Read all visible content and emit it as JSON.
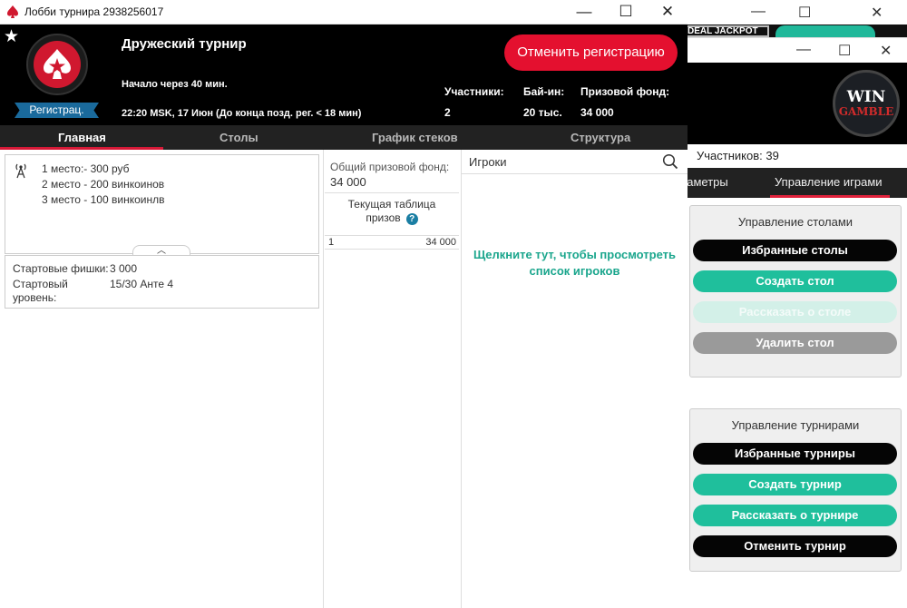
{
  "background_window": {
    "jackpot_label": "DEAL JACKPOT",
    "participants": "Участников: 39",
    "tabs": [
      {
        "label": "раметры"
      },
      {
        "label": "Управление играми"
      }
    ],
    "logo": {
      "line1": "WIN",
      "line2": "GAMBLE"
    },
    "table_panel": {
      "title": "Управление столами",
      "buttons": [
        "Избранные столы",
        "Создать стол",
        "Рассказать о столе",
        "Удалить стол"
      ]
    },
    "tournament_panel": {
      "title": "Управление турнирами",
      "buttons": [
        "Избранные турниры",
        "Создать турнир",
        "Рассказать о турнире",
        "Отменить турнир"
      ]
    }
  },
  "window": {
    "title": "Лобби турнира 2938256017",
    "controls": {
      "minimize": "—",
      "maximize": "☐",
      "close": "✕"
    }
  },
  "header": {
    "tournament_name": "Дружеский турнир",
    "starts_in": "Начало через 40 мин.",
    "date_info": "22:20 MSK, 17 Июн (До конца позд. рег. < 18 мин)",
    "status_badge": "Регистрац.",
    "unregister_label": "Отменить регистрацию",
    "stats": [
      {
        "label": "Участники:",
        "value": "2"
      },
      {
        "label": "Бай-ин:",
        "value": "20 тыс."
      },
      {
        "label": "Призовой фонд:",
        "value": "34 000"
      }
    ]
  },
  "tabs": [
    {
      "label": "Главная"
    },
    {
      "label": "Столы"
    },
    {
      "label": "График стеков"
    },
    {
      "label": "Структура"
    }
  ],
  "main": {
    "prizes": [
      "1 место:- 300 руб",
      "2 место - 200 винкоинов",
      "3 место - 100 винкоинлв"
    ],
    "collapse_glyph": "︿",
    "starting_chips_label": "Стартовые фишки:",
    "starting_chips_value": "3 000",
    "starting_level_label_1": "Стартовый",
    "starting_level_label_2": "уровень:",
    "starting_level_value": "15/30 Анте 4",
    "prize_pool_label": "Общий призовой фонд:",
    "prize_pool_value": "34 000",
    "current_table_line1": "Текущая таблица",
    "current_table_line2": "призов",
    "help_glyph": "?",
    "prize_rows": [
      {
        "place": "1",
        "amount": "34 000"
      }
    ],
    "players_label": "Игроки",
    "players_link_line1": "Щелкните тут, чтобы просмотреть",
    "players_link_line2": "список игроков"
  },
  "colors": {
    "brand_red": "#e4102f",
    "teal": "#1fbf9c",
    "badge_blue": "#1a6a9c"
  }
}
